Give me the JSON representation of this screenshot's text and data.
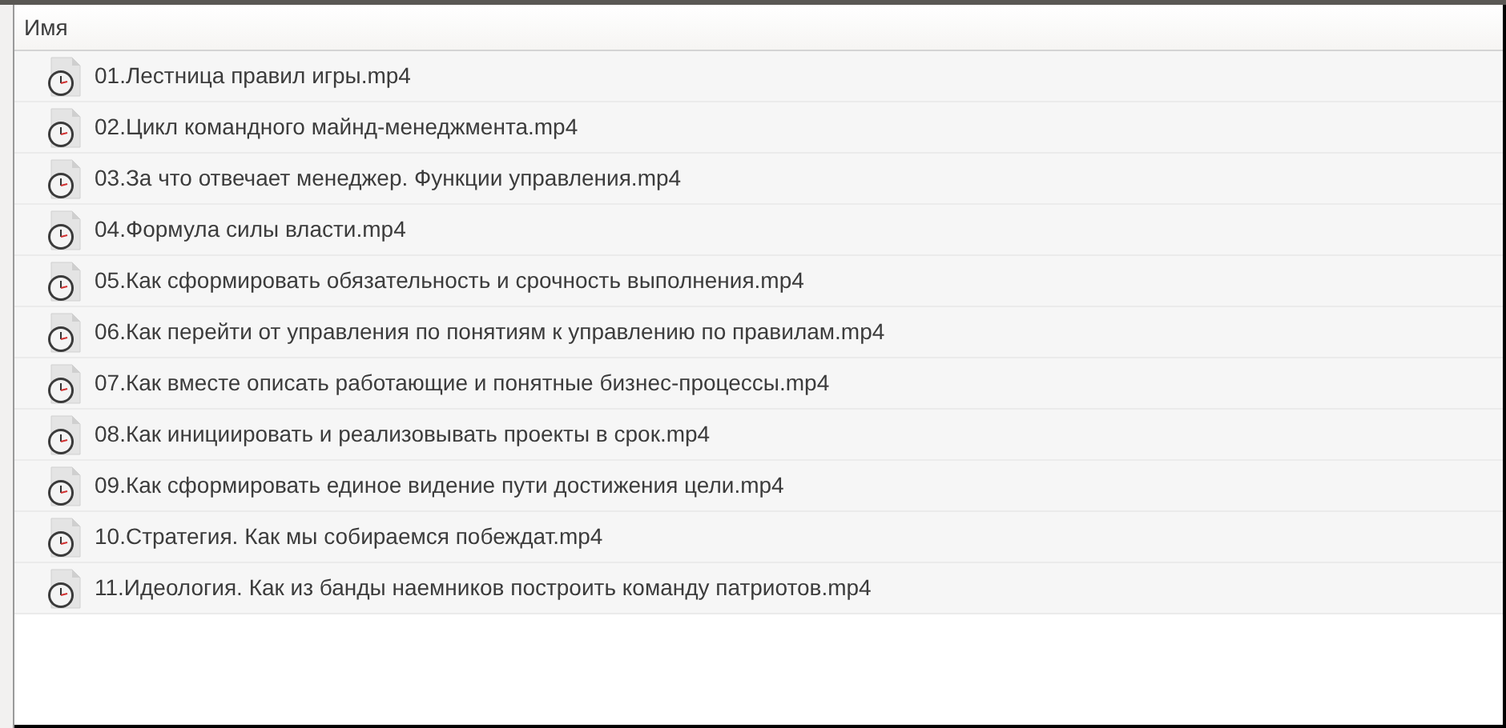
{
  "column_header": "Имя",
  "files": [
    {
      "name": "01.Лестница правил игры.mp4"
    },
    {
      "name": "02.Цикл командного майнд-менеджмента.mp4"
    },
    {
      "name": "03.За что отвечает менеджер. Функции управления.mp4"
    },
    {
      "name": "04.Формула силы власти.mp4"
    },
    {
      "name": "05.Как сформировать обязательность и срочность выполнения.mp4"
    },
    {
      "name": "06.Как перейти от управления по понятиям к управлению по правилам.mp4"
    },
    {
      "name": "07.Как вместе описать работающие и понятные бизнес-процессы.mp4"
    },
    {
      "name": "08.Как инициировать и реализовывать проекты в срок.mp4"
    },
    {
      "name": "09.Как сформировать единое видение пути достижения цели.mp4"
    },
    {
      "name": "10.Стратегия. Как мы собираемся побеждат.mp4"
    },
    {
      "name": "11.Идеология. Как из банды наемников построить команду патриотов.mp4"
    }
  ]
}
